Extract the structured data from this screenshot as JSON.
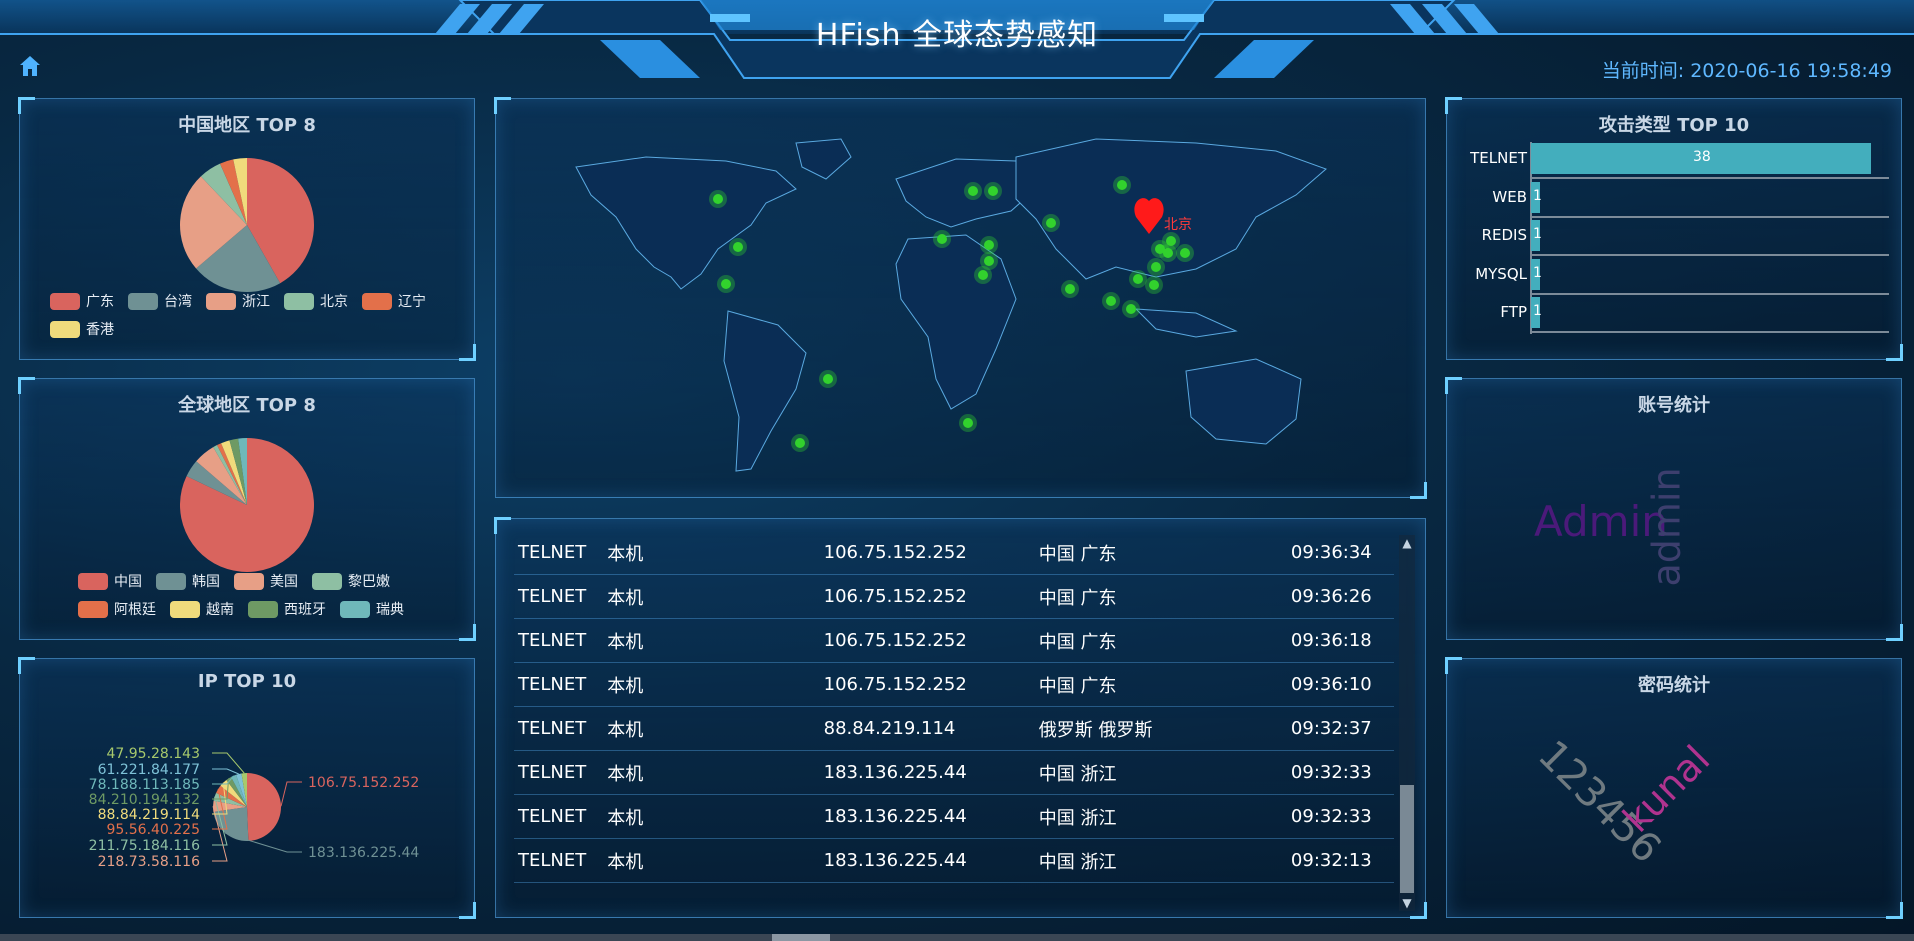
{
  "header": {
    "title": "HFish 全球态势感知",
    "clock_label": "当前时间: 2020-06-16 19:58:49"
  },
  "china_top8": {
    "title": "中国地区 TOP 8",
    "chart_data": {
      "type": "pie",
      "categories": [
        "广东",
        "台湾",
        "浙江",
        "北京",
        "辽宁",
        "香港"
      ],
      "values": [
        38,
        20,
        22,
        5,
        3,
        3
      ],
      "colors": [
        "#d9645e",
        "#6f9194",
        "#e79f86",
        "#8ebfa3",
        "#e3704a",
        "#f0db7c"
      ]
    }
  },
  "global_top8": {
    "title": "全球地区 TOP 8",
    "chart_data": {
      "type": "pie",
      "categories": [
        "中国",
        "韩国",
        "美国",
        "黎巴嫩",
        "阿根廷",
        "越南",
        "西班牙",
        "瑞典"
      ],
      "values": [
        78,
        4,
        5,
        1,
        1,
        2,
        2,
        2
      ],
      "colors": [
        "#d9645e",
        "#6f9194",
        "#e79f86",
        "#8ebfa3",
        "#e3704a",
        "#f0db7c",
        "#6e9a64",
        "#6fb8ba"
      ]
    }
  },
  "ip_top10": {
    "title": "IP TOP 10",
    "chart_data": {
      "type": "pie",
      "categories": [
        "106.75.152.252",
        "183.136.225.44",
        "218.73.58.116",
        "211.75.184.116",
        "95.56.40.225",
        "88.84.219.114",
        "84.210.194.132",
        "78.188.113.185",
        "61.221.84.177",
        "47.95.28.143"
      ],
      "values": [
        38,
        18,
        4,
        3,
        3,
        3,
        2,
        2,
        2,
        2
      ],
      "colors": [
        "#d9645e",
        "#6f9194",
        "#e79f86",
        "#8ebfa3",
        "#e3704a",
        "#f0db7c",
        "#6e9a64",
        "#6fb8ba",
        "#7ec2d7",
        "#a7c96c"
      ]
    }
  },
  "attack_types": {
    "title": "攻击类型 TOP 10",
    "chart_data": {
      "type": "bar",
      "categories": [
        "TELNET",
        "WEB",
        "REDIS",
        "MYSQL",
        "FTP"
      ],
      "values": [
        38,
        1,
        1,
        1,
        1
      ],
      "color": "#43aebd"
    }
  },
  "account_stats": {
    "title": "账号统计",
    "words": [
      {
        "text": "Admin",
        "color": "#4b1a7a"
      },
      {
        "text": "admin",
        "color": "#3d3f6e"
      }
    ]
  },
  "password_stats": {
    "title": "密码统计",
    "words": [
      {
        "text": "123456",
        "color": "#6f7a80"
      },
      {
        "text": "kunal",
        "color": "#b0338f"
      }
    ]
  },
  "map": {
    "origin_label": "北京",
    "origin_color": "#ff1a1a",
    "point_color": "#32d22d"
  },
  "attack_log": {
    "rows": [
      {
        "type": "TELNET",
        "target": "本机",
        "ip": "106.75.152.252",
        "region": "中国 广东",
        "time": "09:36:34"
      },
      {
        "type": "TELNET",
        "target": "本机",
        "ip": "106.75.152.252",
        "region": "中国 广东",
        "time": "09:36:26"
      },
      {
        "type": "TELNET",
        "target": "本机",
        "ip": "106.75.152.252",
        "region": "中国 广东",
        "time": "09:36:18"
      },
      {
        "type": "TELNET",
        "target": "本机",
        "ip": "106.75.152.252",
        "region": "中国 广东",
        "time": "09:36:10"
      },
      {
        "type": "TELNET",
        "target": "本机",
        "ip": "88.84.219.114",
        "region": "俄罗斯 俄罗斯",
        "time": "09:32:37"
      },
      {
        "type": "TELNET",
        "target": "本机",
        "ip": "183.136.225.44",
        "region": "中国 浙江",
        "time": "09:32:33"
      },
      {
        "type": "TELNET",
        "target": "本机",
        "ip": "183.136.225.44",
        "region": "中国 浙江",
        "time": "09:32:33"
      },
      {
        "type": "TELNET",
        "target": "本机",
        "ip": "183.136.225.44",
        "region": "中国 浙江",
        "time": "09:32:13"
      }
    ]
  }
}
